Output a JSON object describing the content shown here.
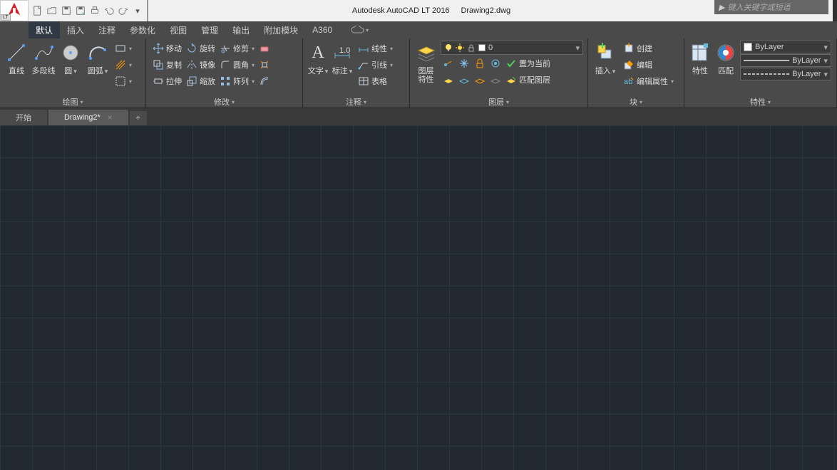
{
  "app": {
    "title": "Autodesk AutoCAD LT 2016",
    "document": "Drawing2.dwg",
    "logo_lt": "LT"
  },
  "search": {
    "placeholder": "键入关键字或短语"
  },
  "menu": {
    "items": [
      "默认",
      "插入",
      "注释",
      "参数化",
      "视图",
      "管理",
      "输出",
      "附加模块",
      "A360"
    ]
  },
  "ribbon": {
    "draw": {
      "title": "绘图",
      "line": "直线",
      "pline": "多段线",
      "circle": "圆",
      "arc": "圆弧"
    },
    "modify": {
      "title": "修改",
      "move": "移动",
      "rotate": "旋转",
      "trim": "修剪",
      "copy": "复制",
      "mirror": "镜像",
      "fillet": "圆角",
      "stretch": "拉伸",
      "scale": "缩放",
      "array": "阵列"
    },
    "annot": {
      "title": "注释",
      "text": "文字",
      "dim": "标注",
      "linear": "线性",
      "leader": "引线",
      "table": "表格"
    },
    "layers": {
      "title": "图层",
      "props": "图层\n特性",
      "current": "0",
      "make_current": "置为当前",
      "match": "匹配图层"
    },
    "block": {
      "title": "块",
      "insert": "插入",
      "create": "创建",
      "edit": "编辑",
      "attedit": "编辑属性"
    },
    "props": {
      "title": "特性",
      "pal": "特性",
      "match": "匹配",
      "bylayer": "ByLayer"
    }
  },
  "tabs": {
    "start": "开始",
    "file": "Drawing2*"
  }
}
